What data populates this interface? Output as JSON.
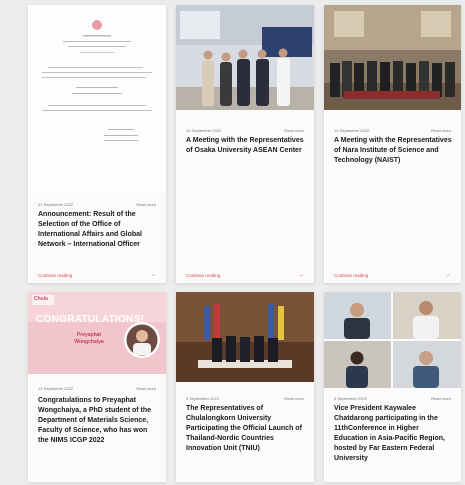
{
  "cards": [
    {
      "date": "21 September 2022",
      "read": "Read more",
      "title": "Announcement: Result of the Selection of the Office of International Affairs and Global Network – International Officer",
      "continue": "Continue reading",
      "arrow": "→"
    },
    {
      "date": "14 September 2022",
      "read": "Read more",
      "title": "A Meeting with the Representatives of Osaka University ASEAN Center",
      "continue": "Continue reading",
      "arrow": "→"
    },
    {
      "date": "14 September 2022",
      "read": "Read more",
      "title": "A Meeting with the Representatives of Nara Institute of Science and Technology (NAIST)",
      "continue": "Continue reading",
      "arrow": "→"
    },
    {
      "date": "13 September 2022",
      "read": "Read more",
      "title": "Congratulations to Preyaphat Wongchaiya, a PhD student of the Department of Materials Science, Faculty of Science, who has won the NIMS ICGP 2022",
      "banner_text": "CONGRATULATIONS!",
      "banner_name": "Preyaphat Wongchaiya",
      "logo_text": "Chula"
    },
    {
      "date": "9 September 2022",
      "read": "Read more",
      "title": "The Representatives of Chulalongkorn University Participating the Official Launch of Thailand-Nordic Countries Innovation Unit (TNIU)"
    },
    {
      "date": "9 September 2022",
      "read": "Read more",
      "title": "Vice President Kaywalee Chatdarong participating in the 11thConference in Higher Education in Asia-Pacific Region, hosted by Far Eastern Federal University"
    }
  ],
  "colors": {
    "accent": "#d24a4a",
    "banner_pink": "#f2c4cc"
  }
}
